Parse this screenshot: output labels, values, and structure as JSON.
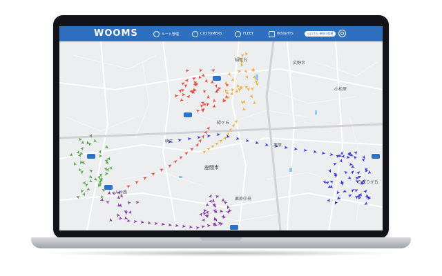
{
  "app": {
    "logo": "WOOMS"
  },
  "nav": {
    "route": "ルート管理",
    "customers": "CUSTOMERS",
    "fleet": "FLEET",
    "insights": "INSIGHTS",
    "pill": "山口さん 神奈川県運"
  },
  "map_labels": {
    "a": "稲荷台",
    "b": "広野台",
    "c": "小松原",
    "d": "緑ケ丘",
    "e": "明王",
    "f": "座間市",
    "g": "栗原",
    "h": "入谷西",
    "i": "栗原中央",
    "j": "ひばりが丘"
  },
  "icons": [
    "route-icon",
    "customers-icon",
    "fleet-icon",
    "insights-icon",
    "settings-icon"
  ],
  "colors": {
    "header": "#2f6fc0",
    "red": "#e84a3a",
    "orange": "#f0b040",
    "green": "#5aa54a",
    "purple": "#8a3aa8",
    "blue": "#3a3ae0",
    "truck": "#2a73c8"
  }
}
